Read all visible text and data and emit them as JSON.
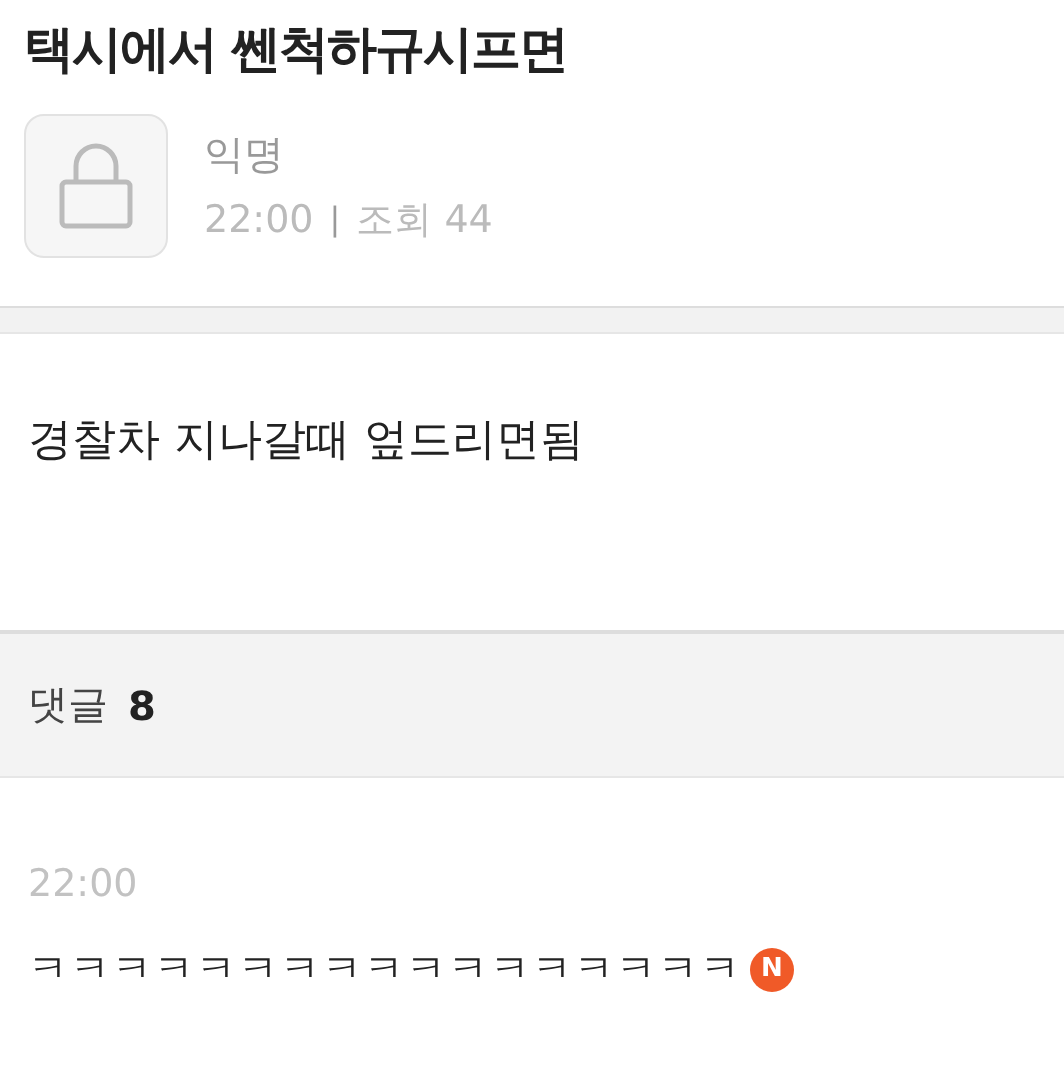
{
  "post": {
    "title": "택시에서 쎈척하규시프면",
    "author": "익명",
    "time": "22:00",
    "separator": "|",
    "views": "조회 44",
    "body": "경찰차 지나갈때 엎드리면됨"
  },
  "comments_header": {
    "label": "댓글",
    "count": "8"
  },
  "comments": [
    {
      "time": "22:00",
      "text": "ㅋㅋㅋㅋㅋㅋㅋㅋㅋㅋㅋㅋㅋㅋㅋㅋㅋ",
      "new_badge": "N"
    }
  ]
}
